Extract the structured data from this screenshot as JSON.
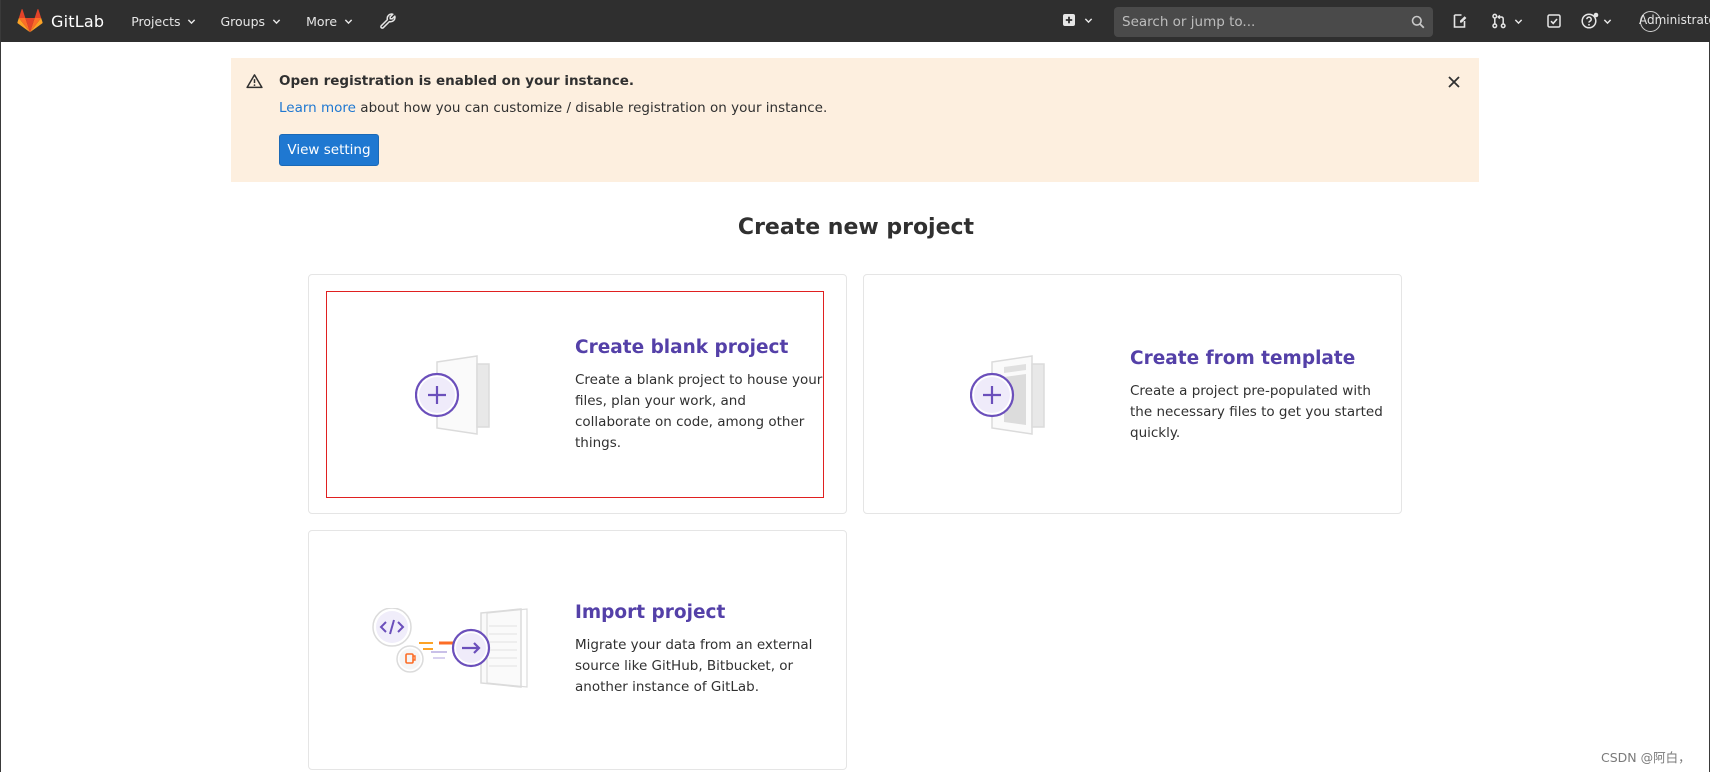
{
  "navbar": {
    "brand": "GitLab",
    "projects_label": "Projects",
    "groups_label": "Groups",
    "more_label": "More",
    "search_placeholder": "Search or jump to...",
    "user_label": "Administrator",
    "icons": [
      "gitlab-logo",
      "chevron-down-icon",
      "wrench-icon",
      "plus-square-icon",
      "search-icon",
      "issues-icon",
      "merge-request-icon",
      "todo-icon",
      "help-icon"
    ]
  },
  "alert": {
    "title": "Open registration is enabled on your instance.",
    "link_text": "Learn more",
    "body_text": " about how you can customize / disable registration on your instance.",
    "button_label": "View setting",
    "icons": [
      "warning-icon",
      "close-icon"
    ]
  },
  "page": {
    "title": "Create new project"
  },
  "cards": [
    {
      "title": "Create blank project",
      "desc_lines": [
        "Create a blank project to house your",
        "files, plan your work, and",
        "collaborate on code, among other",
        "things."
      ]
    },
    {
      "title": "Create from template",
      "desc_lines": [
        "Create a project pre-populated with",
        "the necessary files to get you started",
        "quickly."
      ]
    },
    {
      "title": "Import project",
      "desc_lines": [
        "Migrate your data from an external",
        "source like GitHub, Bitbucket, or",
        "another instance of GitLab."
      ]
    }
  ],
  "watermark": "CSDN @阿白，",
  "colors": {
    "navbar_bg": "#2f2f2f",
    "alert_bg": "#fdefdf",
    "primary_button": "#1f78d1",
    "card_title": "#5440a8",
    "highlight_border": "#e02020",
    "illustration_purple": "#6b4fbb",
    "illustration_orange": "#fc6d26"
  }
}
